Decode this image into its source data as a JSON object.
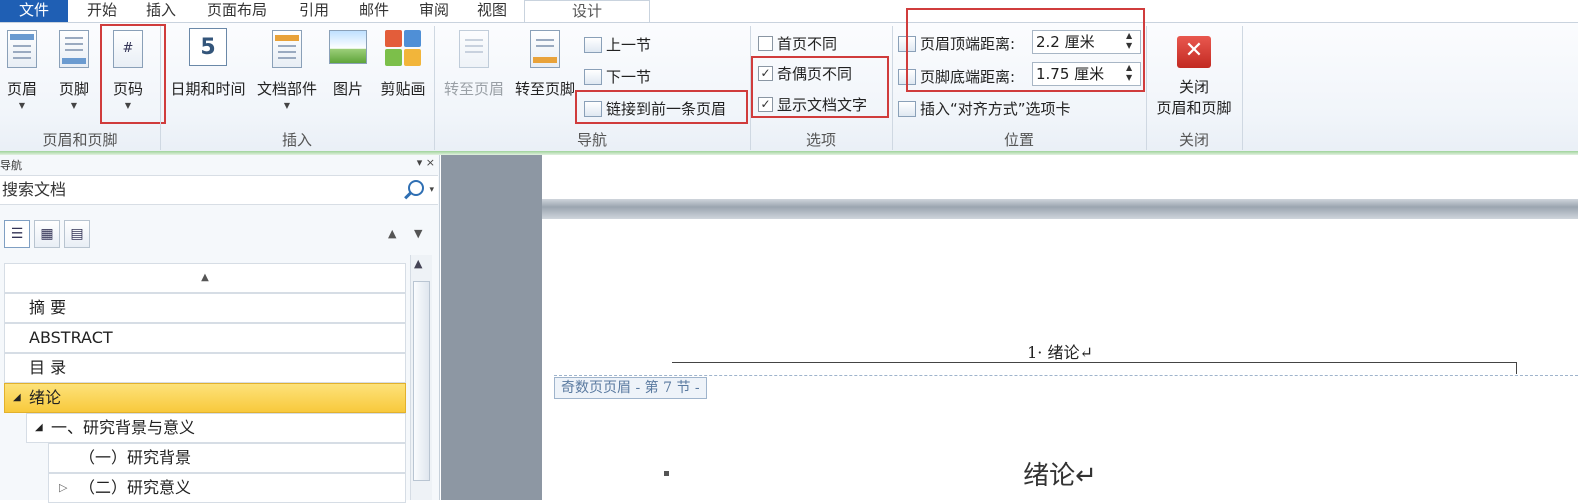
{
  "tabs": {
    "file": "文件",
    "home": "开始",
    "insert": "插入",
    "layout": "页面布局",
    "references": "引用",
    "mailings": "邮件",
    "review": "审阅",
    "view": "视图",
    "design": "设计"
  },
  "ribbon": {
    "header_footer_group": {
      "header": "页眉",
      "footer": "页脚",
      "page_number": "页码",
      "label": "页眉和页脚"
    },
    "insert_group": {
      "date_time": "日期和时间",
      "quick_parts": "文档部件",
      "picture": "图片",
      "clip_art": "剪贴画",
      "label": "插入"
    },
    "navigation_group": {
      "goto_header": "转至页眉",
      "goto_footer": "转至页脚",
      "previous_section": "上一节",
      "next_section": "下一节",
      "link_to_previous": "链接到前一条页眉",
      "label": "导航"
    },
    "options_group": {
      "different_first_page": "首页不同",
      "different_odd_even": "奇偶页不同",
      "show_document_text": "显示文档文字",
      "label": "选项"
    },
    "position_group": {
      "header_from_top_label": "页眉顶端距离:",
      "header_from_top_value": "2.2 厘米",
      "footer_from_bottom_label": "页脚底端距离:",
      "footer_from_bottom_value": "1.75 厘米",
      "insert_alignment_tab": "插入“对齐方式”选项卡",
      "label": "位置"
    },
    "close_group": {
      "close_line1": "关闭",
      "close_line2": "页眉和页脚",
      "label": "关闭"
    }
  },
  "nav_pane": {
    "title": "导航",
    "controls": "▾ ×",
    "search_placeholder": "搜索文档",
    "items": [
      {
        "label": "摘 要"
      },
      {
        "label": "ABSTRACT"
      },
      {
        "label": "目 录"
      },
      {
        "label": "绪论"
      },
      {
        "label": "一、研究背景与意义"
      },
      {
        "label": "（一）研究背景"
      },
      {
        "label": "（二）研究意义"
      }
    ]
  },
  "document": {
    "header_text": "1· 绪论↵",
    "header_tag": "奇数页页眉 - 第 7 节 -",
    "body_title": "绪论↵"
  },
  "colors": {
    "accent_file_tab": "#1f5fb4",
    "highlight_box": "#d03c3c",
    "selected_nav": "#f8c93c"
  }
}
